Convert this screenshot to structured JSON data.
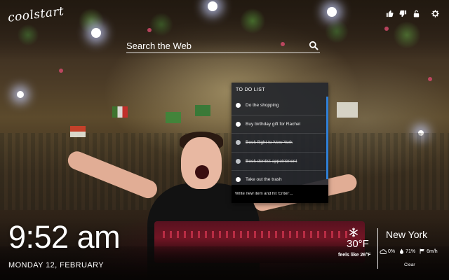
{
  "app": {
    "logo_text": "coolstart"
  },
  "top_icons": [
    {
      "name": "thumbs-up-icon"
    },
    {
      "name": "thumbs-down-icon"
    },
    {
      "name": "unlock-icon"
    },
    {
      "name": "gear-icon"
    }
  ],
  "search": {
    "placeholder": "Search the Web",
    "icon": "search-icon"
  },
  "todo": {
    "title": "TO DO LIST",
    "items": [
      {
        "label": "Do the shopping",
        "done": false
      },
      {
        "label": "Buy birthday gift for Rachel",
        "done": false
      },
      {
        "label": "Book flight to New York",
        "done": true
      },
      {
        "label": "Book dentist appointment",
        "done": true
      },
      {
        "label": "Take out the trash",
        "done": false
      }
    ],
    "input_placeholder": "Write new item and hit 'Enter'..."
  },
  "clock": {
    "time": "9:52 am",
    "date": "MONDAY 12, FEBRUARY"
  },
  "weather": {
    "icon": "snowflake-icon",
    "temperature": "30°F",
    "feels_like": "feels like 26°F",
    "city": "New York",
    "precipitation": "0%",
    "humidity": "71%",
    "wind": "6m/h",
    "condition": "Clear"
  },
  "colors": {
    "todo_accent": "#2f7fd6",
    "panel_bg": "#22262c"
  }
}
